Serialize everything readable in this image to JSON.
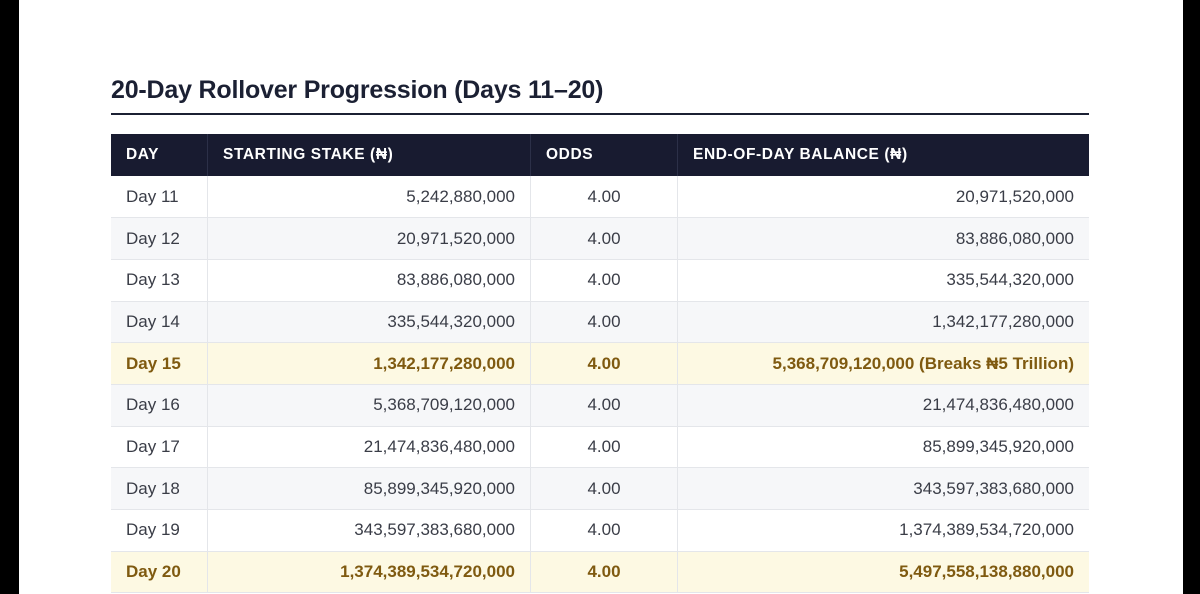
{
  "title": "20-Day Rollover Progression (Days 11–20)",
  "table": {
    "headers": [
      "DAY",
      "STARTING STAKE (₦)",
      "ODDS",
      "END-OF-DAY BALANCE (₦)"
    ],
    "rows": [
      {
        "day": "Day 11",
        "stake": "5,242,880,000",
        "odds": "4.00",
        "balance": "20,971,520,000",
        "highlight": false
      },
      {
        "day": "Day 12",
        "stake": "20,971,520,000",
        "odds": "4.00",
        "balance": "83,886,080,000",
        "highlight": false
      },
      {
        "day": "Day 13",
        "stake": "83,886,080,000",
        "odds": "4.00",
        "balance": "335,544,320,000",
        "highlight": false
      },
      {
        "day": "Day 14",
        "stake": "335,544,320,000",
        "odds": "4.00",
        "balance": "1,342,177,280,000",
        "highlight": false
      },
      {
        "day": "Day 15",
        "stake": "1,342,177,280,000",
        "odds": "4.00",
        "balance": "5,368,709,120,000 (Breaks ₦5 Trillion)",
        "highlight": true
      },
      {
        "day": "Day 16",
        "stake": "5,368,709,120,000",
        "odds": "4.00",
        "balance": "21,474,836,480,000",
        "highlight": false
      },
      {
        "day": "Day 17",
        "stake": "21,474,836,480,000",
        "odds": "4.00",
        "balance": "85,899,345,920,000",
        "highlight": false
      },
      {
        "day": "Day 18",
        "stake": "85,899,345,920,000",
        "odds": "4.00",
        "balance": "343,597,383,680,000",
        "highlight": false
      },
      {
        "day": "Day 19",
        "stake": "343,597,383,680,000",
        "odds": "4.00",
        "balance": "1,374,389,534,720,000",
        "highlight": false
      },
      {
        "day": "Day 20",
        "stake": "1,374,389,534,720,000",
        "odds": "4.00",
        "balance": "5,497,558,138,880,000",
        "highlight": true
      }
    ]
  },
  "colors": {
    "header_bg": "#181b30",
    "highlight_bg": "#fdf9e3",
    "highlight_text": "#7f5a10",
    "title_text": "#1b2033"
  }
}
